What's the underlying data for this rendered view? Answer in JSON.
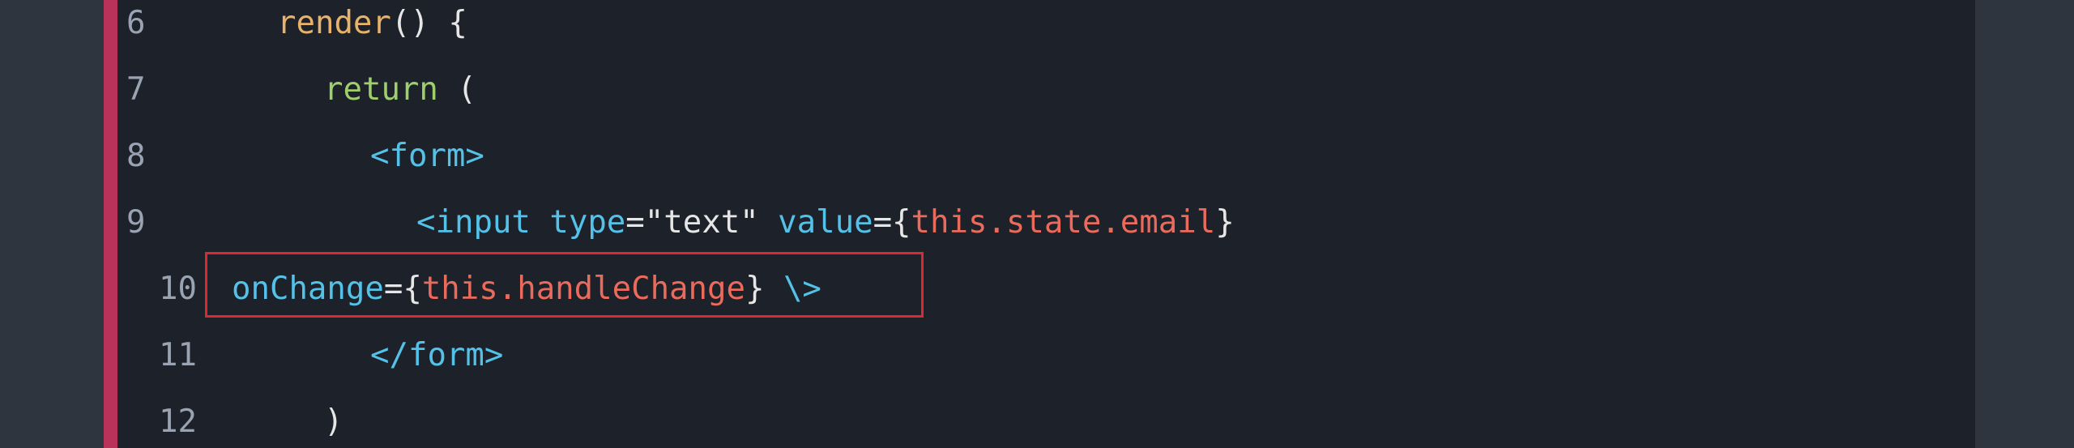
{
  "colors": {
    "page_background": "#2f353e",
    "editor_background": "#1d2129",
    "accent_bar": "#b8325a",
    "highlight_box": "#e0272d",
    "line_number": "#9aa3b1",
    "function_name": "#e7b36a",
    "keyword": "#9fcf6d",
    "tag_and_attribute": "#54c2e8",
    "string": "#e6e6e6",
    "expression": "#ea6a5b"
  },
  "lines": [
    {
      "number": "6",
      "tokens": [
        {
          "text": "render",
          "kind": "func"
        },
        {
          "text": "() {",
          "kind": "punc"
        }
      ]
    },
    {
      "number": "7",
      "tokens": [
        {
          "text": "return",
          "kind": "keyword"
        },
        {
          "text": " (",
          "kind": "punc"
        }
      ]
    },
    {
      "number": "8",
      "tokens": [
        {
          "text": "<form>",
          "kind": "tag"
        }
      ]
    },
    {
      "number": "9",
      "tokens": [
        {
          "text": "<input",
          "kind": "tag"
        },
        {
          "text": " type",
          "kind": "attr"
        },
        {
          "text": "=",
          "kind": "punc"
        },
        {
          "text": "\"text\"",
          "kind": "string"
        },
        {
          "text": " value",
          "kind": "attr"
        },
        {
          "text": "={",
          "kind": "punc"
        },
        {
          "text": "this.state.email",
          "kind": "expr"
        },
        {
          "text": "}",
          "kind": "punc"
        }
      ]
    },
    {
      "number": "10",
      "tokens": [
        {
          "text": "onChange",
          "kind": "attr"
        },
        {
          "text": "={",
          "kind": "punc"
        },
        {
          "text": "this.handleChange",
          "kind": "expr"
        },
        {
          "text": "} ",
          "kind": "punc"
        },
        {
          "text": "\\>",
          "kind": "tag"
        }
      ]
    },
    {
      "number": "11",
      "tokens": [
        {
          "text": "</form>",
          "kind": "tag"
        }
      ]
    },
    {
      "number": "12",
      "tokens": [
        {
          "text": ")",
          "kind": "punc"
        }
      ]
    }
  ]
}
